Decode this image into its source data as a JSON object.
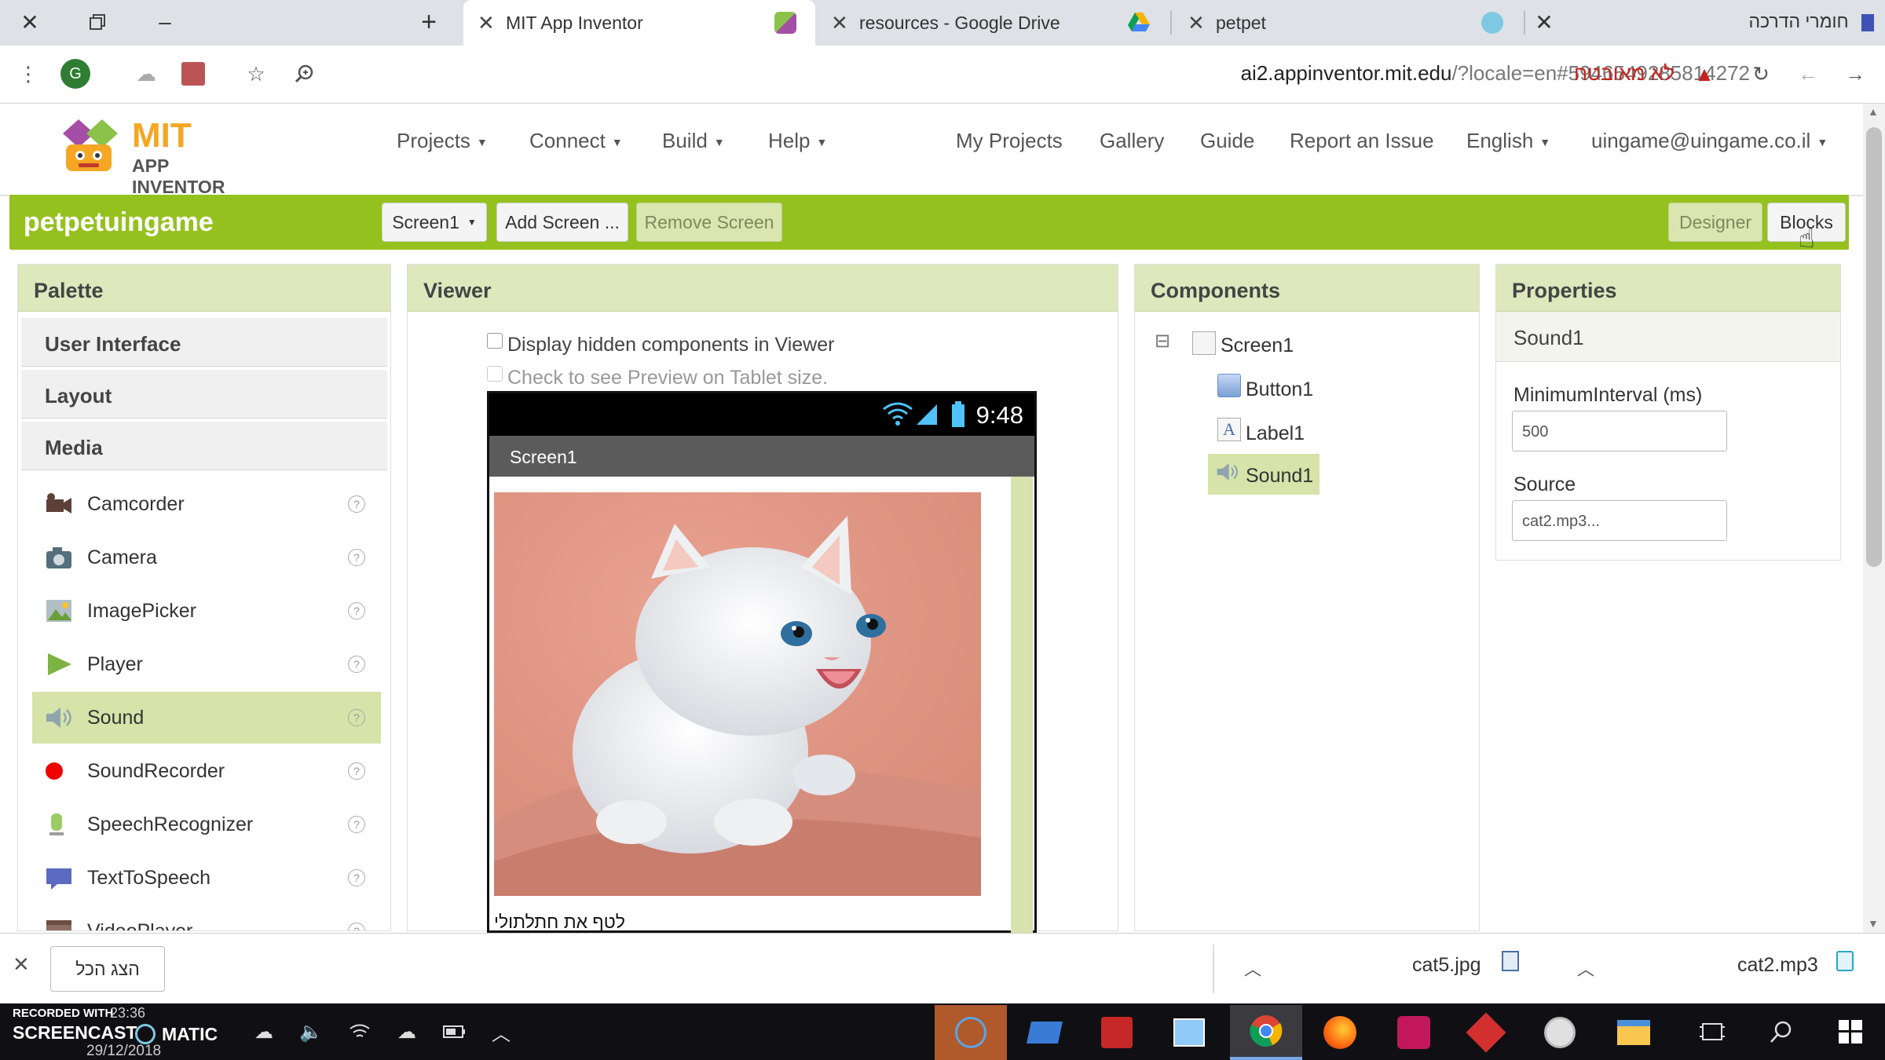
{
  "browser": {
    "tabs": [
      {
        "title": "MIT App Inventor",
        "active": true
      },
      {
        "title": "resources - Google Drive",
        "active": false
      },
      {
        "title": "petpet",
        "active": false
      }
    ],
    "new_tab": "+",
    "bookmark_folder": "חומרי הדרכה",
    "url": "ai2.appinventor.mit.edu",
    "url_rest": "/?locale=en#5946549285814272",
    "security_text": "לא מאובטח"
  },
  "appinventor": {
    "logo_line1": "MIT",
    "logo_line2": "APP INVENTOR",
    "menus": [
      "Projects",
      "Connect",
      "Build",
      "Help"
    ],
    "links": [
      "My Projects",
      "Gallery",
      "Guide",
      "Report an Issue"
    ],
    "language": "English",
    "account": "uingame@uingame.co.il"
  },
  "project": {
    "name": "petpetuingame",
    "screen_select": "Screen1",
    "add_screen": "Add Screen ...",
    "remove_screen": "Remove Screen",
    "designer": "Designer",
    "blocks": "Blocks"
  },
  "palette": {
    "title": "Palette",
    "categories": [
      "User Interface",
      "Layout",
      "Media"
    ],
    "items": [
      {
        "label": "Camcorder",
        "icon": "camcorder-icon"
      },
      {
        "label": "Camera",
        "icon": "camera-icon"
      },
      {
        "label": "ImagePicker",
        "icon": "image-picker-icon"
      },
      {
        "label": "Player",
        "icon": "player-icon"
      },
      {
        "label": "Sound",
        "icon": "sound-icon",
        "selected": true
      },
      {
        "label": "SoundRecorder",
        "icon": "sound-recorder-icon"
      },
      {
        "label": "SpeechRecognizer",
        "icon": "speech-recognizer-icon"
      },
      {
        "label": "TextToSpeech",
        "icon": "text-to-speech-icon"
      },
      {
        "label": "VideoPlayer",
        "icon": "video-player-icon"
      }
    ],
    "help_glyph": "?"
  },
  "viewer": {
    "title": "Viewer",
    "hidden_components_label": "Display hidden components in Viewer",
    "tablet_preview_label": "Check to see Preview on Tablet size.",
    "clock": "9:48",
    "screen_title": "Screen1",
    "label_text": "לטף את חתלתולי"
  },
  "components": {
    "title": "Components",
    "tree": [
      {
        "label": "Screen1",
        "icon": "screen-icon"
      },
      {
        "label": "Button1",
        "icon": "button-icon"
      },
      {
        "label": "Label1",
        "icon": "label-icon"
      },
      {
        "label": "Sound1",
        "icon": "sound-icon",
        "selected": true
      }
    ],
    "collapse_glyph": "⊟"
  },
  "properties": {
    "title": "Properties",
    "component": "Sound1",
    "fields": [
      {
        "label": "MinimumInterval (ms)",
        "value": "500"
      },
      {
        "label": "Source",
        "value": "cat2.mp3..."
      }
    ]
  },
  "downloads": {
    "show_all": "הצג הכל",
    "files": [
      "cat5.jpg",
      "cat2.mp3"
    ]
  },
  "taskbar": {
    "recorded_line1": "RECORDED WITH",
    "recorded_line2": "SCREENCAST",
    "recorded_line3": "MATIC",
    "time": "23:36",
    "date": "29/12/2018"
  },
  "colors": {
    "accent_green": "#95c11f",
    "panel_header": "#dde8bd",
    "selection": "#d6e3a9"
  }
}
